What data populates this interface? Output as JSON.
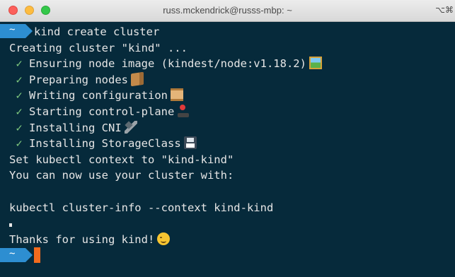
{
  "window": {
    "title": "russ.mckendrick@russs-mbp: ~",
    "shortcut": "⌥⌘"
  },
  "prompt": {
    "cwd": "~"
  },
  "colors": {
    "background": "#062a3b",
    "prompt_badge": "#2d8ed1",
    "check": "#7fc97f",
    "cursor": "#f26b1d"
  },
  "terminal": {
    "command": "kind create cluster",
    "creating": "Creating cluster \"kind\" ...",
    "check_mark": "✓",
    "steps": [
      {
        "text": "Ensuring node image (kindest/node:v1.18.2)",
        "icon": "framed-picture-icon"
      },
      {
        "text": "Preparing nodes",
        "icon": "package-icon"
      },
      {
        "text": "Writing configuration",
        "icon": "scroll-icon"
      },
      {
        "text": "Starting control-plane",
        "icon": "joystick-icon"
      },
      {
        "text": "Installing CNI",
        "icon": "electric-plug-icon"
      },
      {
        "text": "Installing StorageClass",
        "icon": "floppy-disk-icon"
      }
    ],
    "context_line": "Set kubectl context to \"kind-kind\"",
    "usage_line": "You can now use your cluster with:",
    "example_command": "kubectl cluster-info --context kind-kind",
    "thanks_line": "Thanks for using kind!",
    "thanks_icon": "smiling-face-icon"
  }
}
